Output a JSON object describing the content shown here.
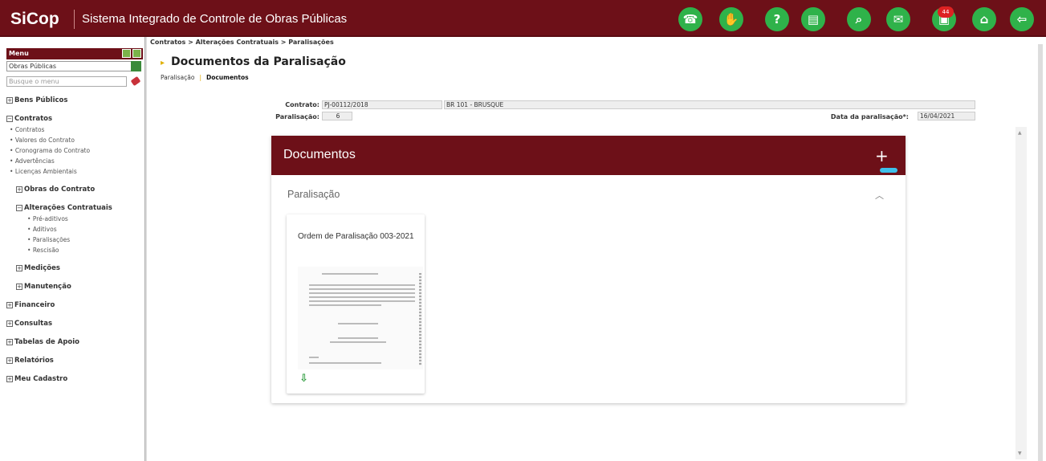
{
  "header": {
    "logo": "SiCop",
    "title": "Sistema Integrado de Controle de Obras Públicas",
    "notif_count": "44",
    "icons": [
      "phone-icon",
      "handshake-icon",
      "help-icon",
      "book-icon",
      "chat-search-icon",
      "mail-icon",
      "notification-icon",
      "home-icon",
      "logout-icon"
    ],
    "accent": "#6d1018"
  },
  "menu": {
    "label": "Menu",
    "select_value": "Obras Públicas",
    "search_placeholder": "Busque o menu",
    "items": {
      "bens": "Bens Públicos",
      "contratos": "Contratos",
      "contratos_sub": [
        "Contratos",
        "Valores do Contrato",
        "Cronograma do Contrato",
        "Advertências",
        "Licenças Ambientais"
      ],
      "obras": "Obras do Contrato",
      "alteracoes": "Alterações Contratuais",
      "alteracoes_sub": [
        "Pré-aditivos",
        "Aditivos",
        "Paralisações",
        "Rescisão"
      ],
      "medicoes": "Medições",
      "manutencao": "Manutenção",
      "financeiro": "Financeiro",
      "consultas": "Consultas",
      "tabelas": "Tabelas de Apoio",
      "relatorios": "Relatórios",
      "cadastro": "Meu Cadastro"
    }
  },
  "breadcrumb": "Contratos > Alterações Contratuais > Paralisações",
  "page_title": "Documentos da Paralisação",
  "subnav": {
    "link": "Paralisação",
    "active": "Documentos"
  },
  "form": {
    "contrato_label": "Contrato:",
    "contrato_value": "PJ-00112/2018",
    "contrato_desc": "BR 101 - BRUSQUE",
    "paralisacao_label": "Paralisação:",
    "paralisacao_value": "6",
    "data_label": "Data da paralisação*:",
    "data_value": "16/04/2021"
  },
  "documents": {
    "title": "Documentos",
    "add_label": "+",
    "section": "Paralisação",
    "doc_title": "Ordem de Paralisação 003-2021"
  }
}
